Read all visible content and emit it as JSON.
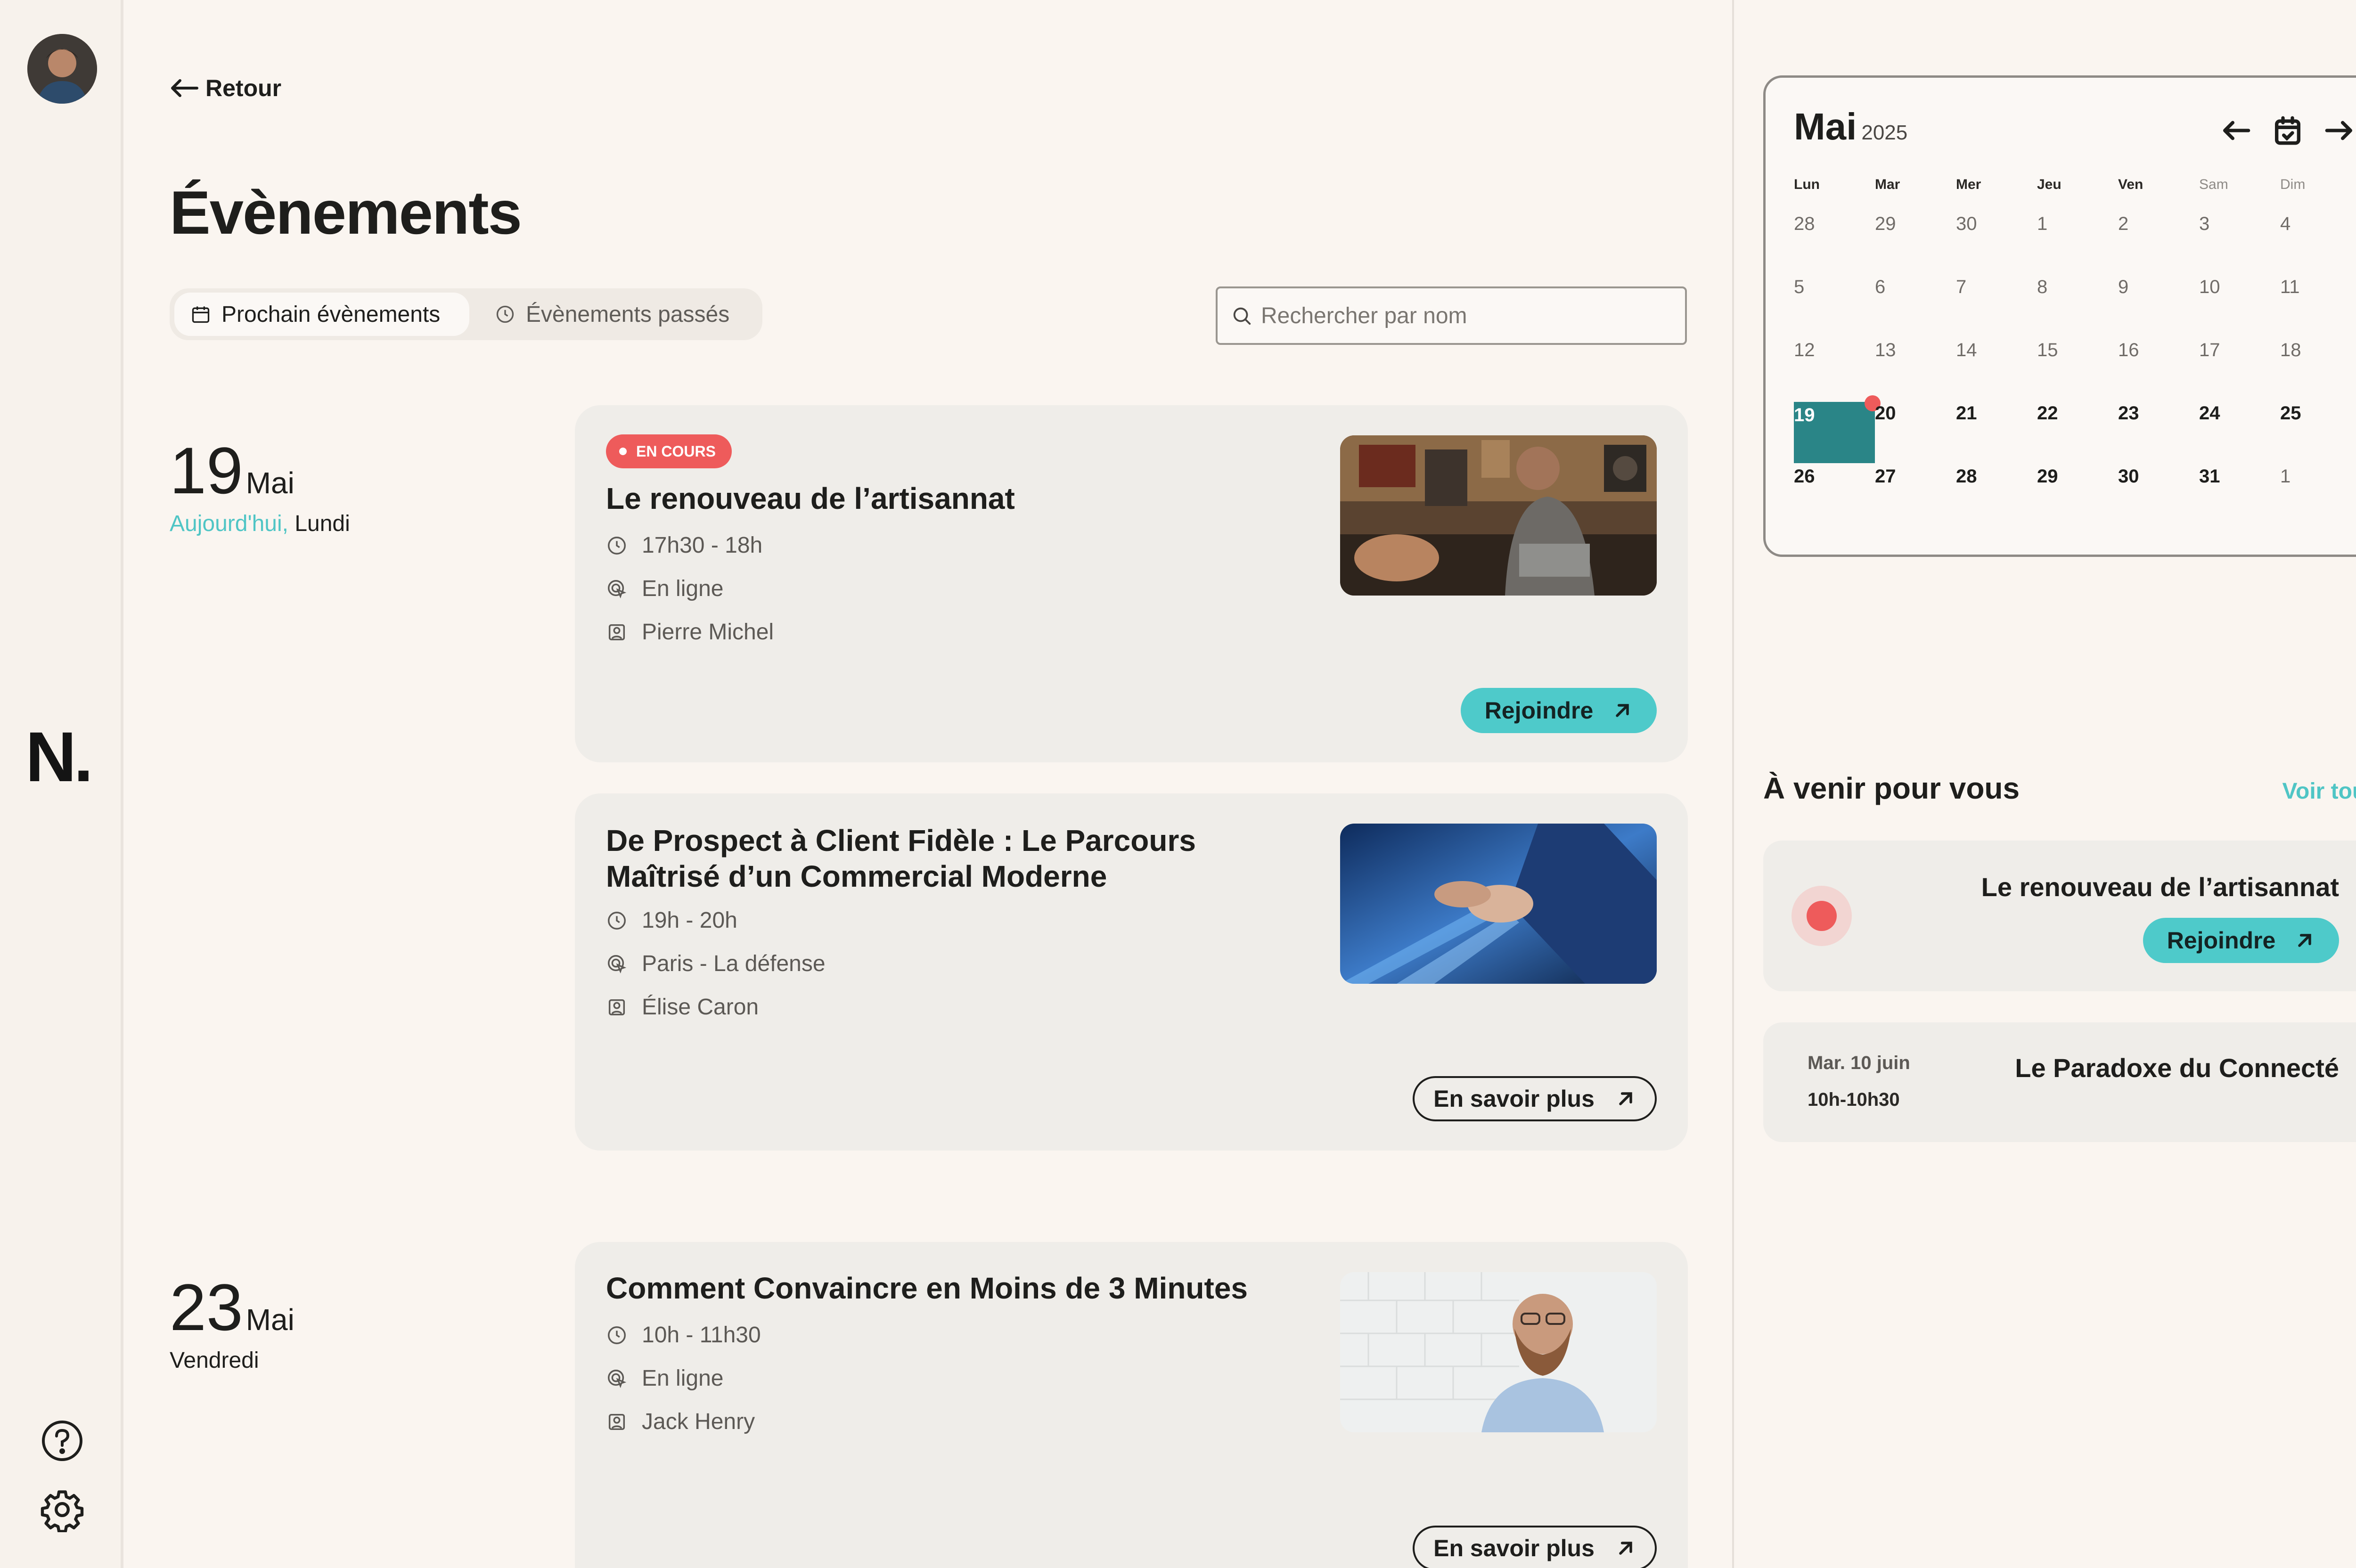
{
  "nav": {
    "back_label": "Retour"
  },
  "page": {
    "title": "Évènements"
  },
  "tabs": [
    {
      "label": "Prochain évènements",
      "active": true
    },
    {
      "label": "Évènements passés",
      "active": false
    }
  ],
  "search": {
    "placeholder": "Rechercher par nom",
    "value": ""
  },
  "days": [
    {
      "day": "19",
      "month": "Mai",
      "today_label": "Aujourd'hui,",
      "weekday": "Lundi"
    },
    {
      "day": "23",
      "month": "Mai",
      "weekday": "Vendredi"
    }
  ],
  "events": [
    {
      "badge": "EN COURS",
      "title": "Le renouveau de l’artisannat",
      "time": "17h30 - 18h",
      "location": "En ligne",
      "host": "Pierre Michel",
      "action": "Rejoindre",
      "image_icon": "workshop-photo"
    },
    {
      "title": "De Prospect à Client Fidèle : Le Parcours Maîtrisé d’un Commercial Moderne",
      "time": "19h - 20h",
      "location": "Paris - La défense",
      "host": "Élise Caron",
      "action": "En savoir plus",
      "image_icon": "handshake-photo"
    },
    {
      "title": "Comment Convaincre en Moins de 3 Minutes",
      "time": "10h - 11h30",
      "location": "En ligne",
      "host": "Jack Henry",
      "action": "En savoir plus",
      "image_icon": "portrait-photo"
    }
  ],
  "calendar": {
    "month": "Mai",
    "year": "2025",
    "weekdays": [
      "Lun",
      "Mar",
      "Mer",
      "Jeu",
      "Ven",
      "Sam",
      "Dim"
    ],
    "weeks": [
      [
        "28",
        "29",
        "30",
        "1",
        "2",
        "3",
        "4"
      ],
      [
        "5",
        "6",
        "7",
        "8",
        "9",
        "10",
        "11"
      ],
      [
        "12",
        "13",
        "14",
        "15",
        "16",
        "17",
        "18"
      ],
      [
        "19",
        "20",
        "21",
        "22",
        "23",
        "24",
        "25"
      ],
      [
        "26",
        "27",
        "28",
        "29",
        "30",
        "31",
        "1"
      ]
    ],
    "selected": "19"
  },
  "upcoming": {
    "title": "À venir pour vous",
    "see_all": "Voir tous",
    "items": [
      {
        "title": "Le renouveau de l’artisannat",
        "action": "Rejoindre",
        "live": true
      },
      {
        "date": "Mar. 10 juin",
        "time": "10h-10h30",
        "title": "Le Paradoxe du Connecté"
      }
    ]
  },
  "colors": {
    "accent": "#4ECACA",
    "accent_text": "#4FC5C5",
    "live": "#EE5B5B",
    "selected_day": "#2A8587",
    "background": "#FAF5F0",
    "card": "#EFEDE9"
  }
}
